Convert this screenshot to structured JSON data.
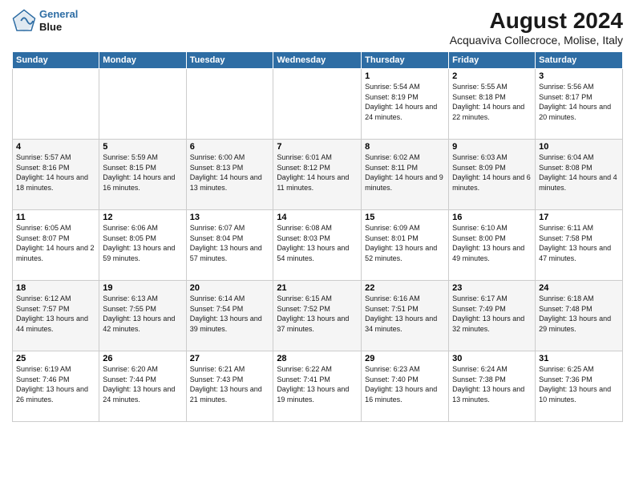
{
  "header": {
    "logo_line1": "General",
    "logo_line2": "Blue",
    "title": "August 2024",
    "subtitle": "Acquaviva Collecroce, Molise, Italy"
  },
  "days_of_week": [
    "Sunday",
    "Monday",
    "Tuesday",
    "Wednesday",
    "Thursday",
    "Friday",
    "Saturday"
  ],
  "weeks": [
    [
      {
        "day": "",
        "info": ""
      },
      {
        "day": "",
        "info": ""
      },
      {
        "day": "",
        "info": ""
      },
      {
        "day": "",
        "info": ""
      },
      {
        "day": "1",
        "info": "Sunrise: 5:54 AM\nSunset: 8:19 PM\nDaylight: 14 hours\nand 24 minutes."
      },
      {
        "day": "2",
        "info": "Sunrise: 5:55 AM\nSunset: 8:18 PM\nDaylight: 14 hours\nand 22 minutes."
      },
      {
        "day": "3",
        "info": "Sunrise: 5:56 AM\nSunset: 8:17 PM\nDaylight: 14 hours\nand 20 minutes."
      }
    ],
    [
      {
        "day": "4",
        "info": "Sunrise: 5:57 AM\nSunset: 8:16 PM\nDaylight: 14 hours\nand 18 minutes."
      },
      {
        "day": "5",
        "info": "Sunrise: 5:59 AM\nSunset: 8:15 PM\nDaylight: 14 hours\nand 16 minutes."
      },
      {
        "day": "6",
        "info": "Sunrise: 6:00 AM\nSunset: 8:13 PM\nDaylight: 14 hours\nand 13 minutes."
      },
      {
        "day": "7",
        "info": "Sunrise: 6:01 AM\nSunset: 8:12 PM\nDaylight: 14 hours\nand 11 minutes."
      },
      {
        "day": "8",
        "info": "Sunrise: 6:02 AM\nSunset: 8:11 PM\nDaylight: 14 hours\nand 9 minutes."
      },
      {
        "day": "9",
        "info": "Sunrise: 6:03 AM\nSunset: 8:09 PM\nDaylight: 14 hours\nand 6 minutes."
      },
      {
        "day": "10",
        "info": "Sunrise: 6:04 AM\nSunset: 8:08 PM\nDaylight: 14 hours\nand 4 minutes."
      }
    ],
    [
      {
        "day": "11",
        "info": "Sunrise: 6:05 AM\nSunset: 8:07 PM\nDaylight: 14 hours\nand 2 minutes."
      },
      {
        "day": "12",
        "info": "Sunrise: 6:06 AM\nSunset: 8:05 PM\nDaylight: 13 hours\nand 59 minutes."
      },
      {
        "day": "13",
        "info": "Sunrise: 6:07 AM\nSunset: 8:04 PM\nDaylight: 13 hours\nand 57 minutes."
      },
      {
        "day": "14",
        "info": "Sunrise: 6:08 AM\nSunset: 8:03 PM\nDaylight: 13 hours\nand 54 minutes."
      },
      {
        "day": "15",
        "info": "Sunrise: 6:09 AM\nSunset: 8:01 PM\nDaylight: 13 hours\nand 52 minutes."
      },
      {
        "day": "16",
        "info": "Sunrise: 6:10 AM\nSunset: 8:00 PM\nDaylight: 13 hours\nand 49 minutes."
      },
      {
        "day": "17",
        "info": "Sunrise: 6:11 AM\nSunset: 7:58 PM\nDaylight: 13 hours\nand 47 minutes."
      }
    ],
    [
      {
        "day": "18",
        "info": "Sunrise: 6:12 AM\nSunset: 7:57 PM\nDaylight: 13 hours\nand 44 minutes."
      },
      {
        "day": "19",
        "info": "Sunrise: 6:13 AM\nSunset: 7:55 PM\nDaylight: 13 hours\nand 42 minutes."
      },
      {
        "day": "20",
        "info": "Sunrise: 6:14 AM\nSunset: 7:54 PM\nDaylight: 13 hours\nand 39 minutes."
      },
      {
        "day": "21",
        "info": "Sunrise: 6:15 AM\nSunset: 7:52 PM\nDaylight: 13 hours\nand 37 minutes."
      },
      {
        "day": "22",
        "info": "Sunrise: 6:16 AM\nSunset: 7:51 PM\nDaylight: 13 hours\nand 34 minutes."
      },
      {
        "day": "23",
        "info": "Sunrise: 6:17 AM\nSunset: 7:49 PM\nDaylight: 13 hours\nand 32 minutes."
      },
      {
        "day": "24",
        "info": "Sunrise: 6:18 AM\nSunset: 7:48 PM\nDaylight: 13 hours\nand 29 minutes."
      }
    ],
    [
      {
        "day": "25",
        "info": "Sunrise: 6:19 AM\nSunset: 7:46 PM\nDaylight: 13 hours\nand 26 minutes."
      },
      {
        "day": "26",
        "info": "Sunrise: 6:20 AM\nSunset: 7:44 PM\nDaylight: 13 hours\nand 24 minutes."
      },
      {
        "day": "27",
        "info": "Sunrise: 6:21 AM\nSunset: 7:43 PM\nDaylight: 13 hours\nand 21 minutes."
      },
      {
        "day": "28",
        "info": "Sunrise: 6:22 AM\nSunset: 7:41 PM\nDaylight: 13 hours\nand 19 minutes."
      },
      {
        "day": "29",
        "info": "Sunrise: 6:23 AM\nSunset: 7:40 PM\nDaylight: 13 hours\nand 16 minutes."
      },
      {
        "day": "30",
        "info": "Sunrise: 6:24 AM\nSunset: 7:38 PM\nDaylight: 13 hours\nand 13 minutes."
      },
      {
        "day": "31",
        "info": "Sunrise: 6:25 AM\nSunset: 7:36 PM\nDaylight: 13 hours\nand 10 minutes."
      }
    ]
  ]
}
